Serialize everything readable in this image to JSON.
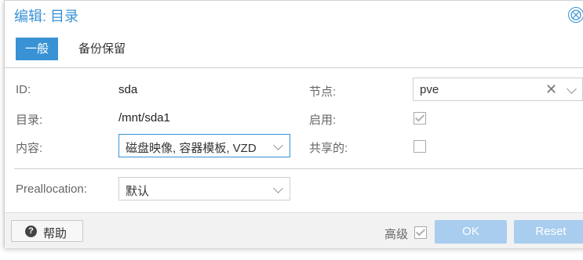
{
  "dialog": {
    "title": "编辑: 目录",
    "close_icon": "⨂"
  },
  "tabs": [
    {
      "label": "一般",
      "active": true
    },
    {
      "label": "备份保留",
      "active": false
    }
  ],
  "form": {
    "id_label": "ID:",
    "id_value": "sda",
    "dir_label": "目录:",
    "dir_value": "/mnt/sda1",
    "content_label": "内容:",
    "content_value": "磁盘映像, 容器模板, VZD",
    "node_label": "节点:",
    "node_value": "pve",
    "enable_label": "启用:",
    "enable_checked": true,
    "shared_label": "共享的:",
    "shared_checked": false,
    "prealloc_label": "Preallocation:",
    "prealloc_value": "默认"
  },
  "footer": {
    "help_label": "帮助",
    "help_icon": "?",
    "advanced_label": "高级",
    "advanced_checked": true,
    "ok_label": "OK",
    "reset_label": "Reset"
  },
  "colors": {
    "accent": "#3892d4",
    "disabled_button": "#a9cdee",
    "footer_bg": "#f2f2f2"
  }
}
